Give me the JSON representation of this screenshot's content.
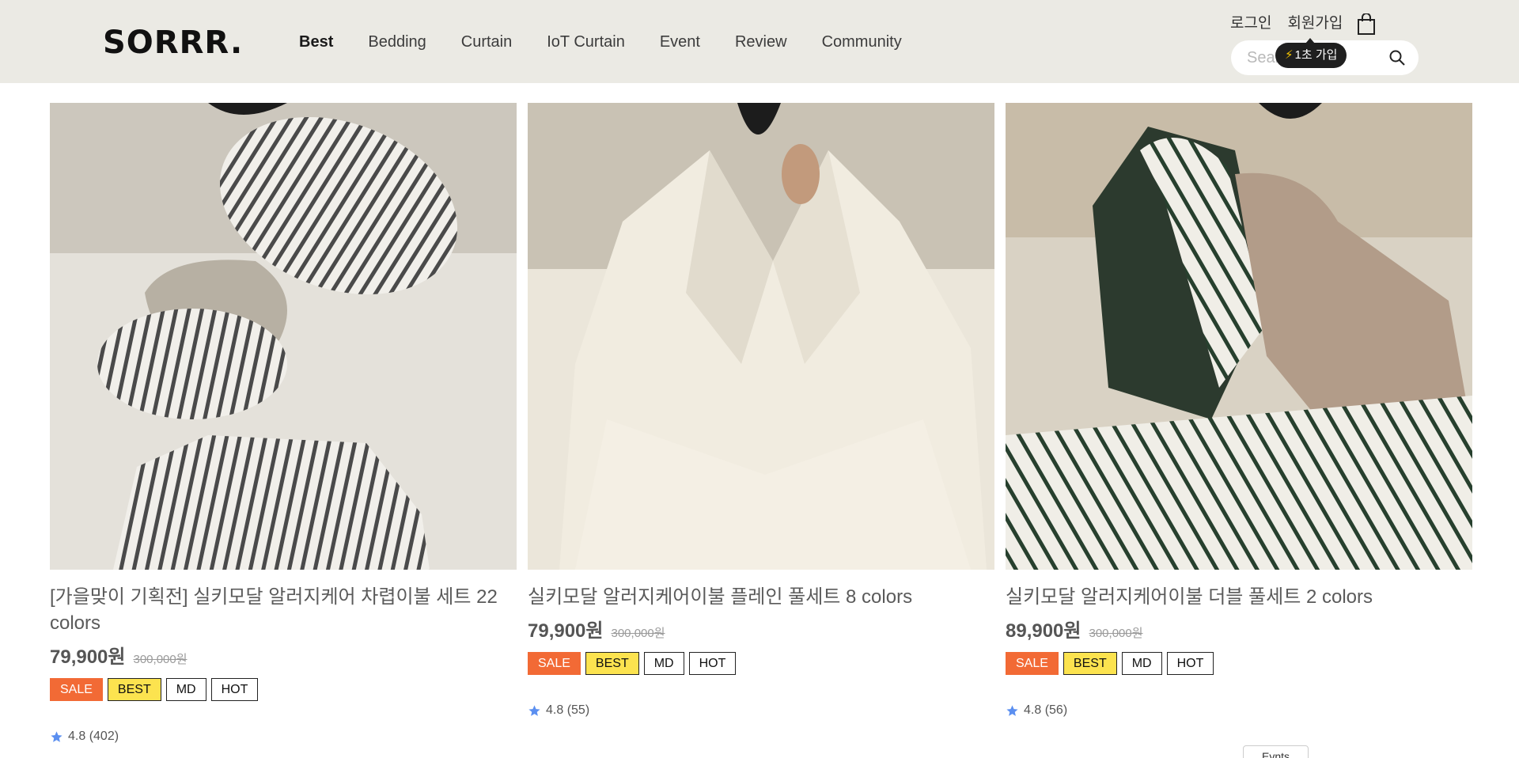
{
  "header": {
    "logo": "SORRR.",
    "nav": [
      {
        "label": "Best",
        "active": true
      },
      {
        "label": "Bedding"
      },
      {
        "label": "Curtain"
      },
      {
        "label": "IoT Curtain"
      },
      {
        "label": "Event"
      },
      {
        "label": "Review"
      },
      {
        "label": "Community"
      }
    ],
    "login_label": "로그인",
    "signup_label": "회원가입",
    "cart_icon": "shopping-bag-icon",
    "search": {
      "placeholder": "Search",
      "icon": "search-icon"
    },
    "signup_tooltip": "1초 가입",
    "tooltip_icon": "⚡"
  },
  "products": [
    {
      "title": "[가을맞이 기획전] 실키모달 알러지케어 차렵이불 세트 22 colors",
      "price": "79,900원",
      "original_price": "300,000원",
      "badges": [
        "SALE",
        "BEST",
        "MD",
        "HOT"
      ],
      "rating": "4.8 (402)"
    },
    {
      "title": "실키모달 알러지케어이불 플레인 풀세트 8 colors",
      "price": "79,900원",
      "original_price": "300,000원",
      "badges": [
        "SALE",
        "BEST",
        "MD",
        "HOT"
      ],
      "rating": "4.8 (55)"
    },
    {
      "title": "실키모달 알러지케어이불 더블 풀세트 2 colors",
      "price": "89,900원",
      "original_price": "300,000원",
      "badges": [
        "SALE",
        "BEST",
        "MD",
        "HOT"
      ],
      "rating": "4.8 (56)"
    }
  ],
  "floating_tab": "Evnts",
  "colors": {
    "header_bg": "#ebeae4",
    "sale": "#f26a35",
    "best": "#fce34f",
    "star": "#5b8ff0"
  }
}
